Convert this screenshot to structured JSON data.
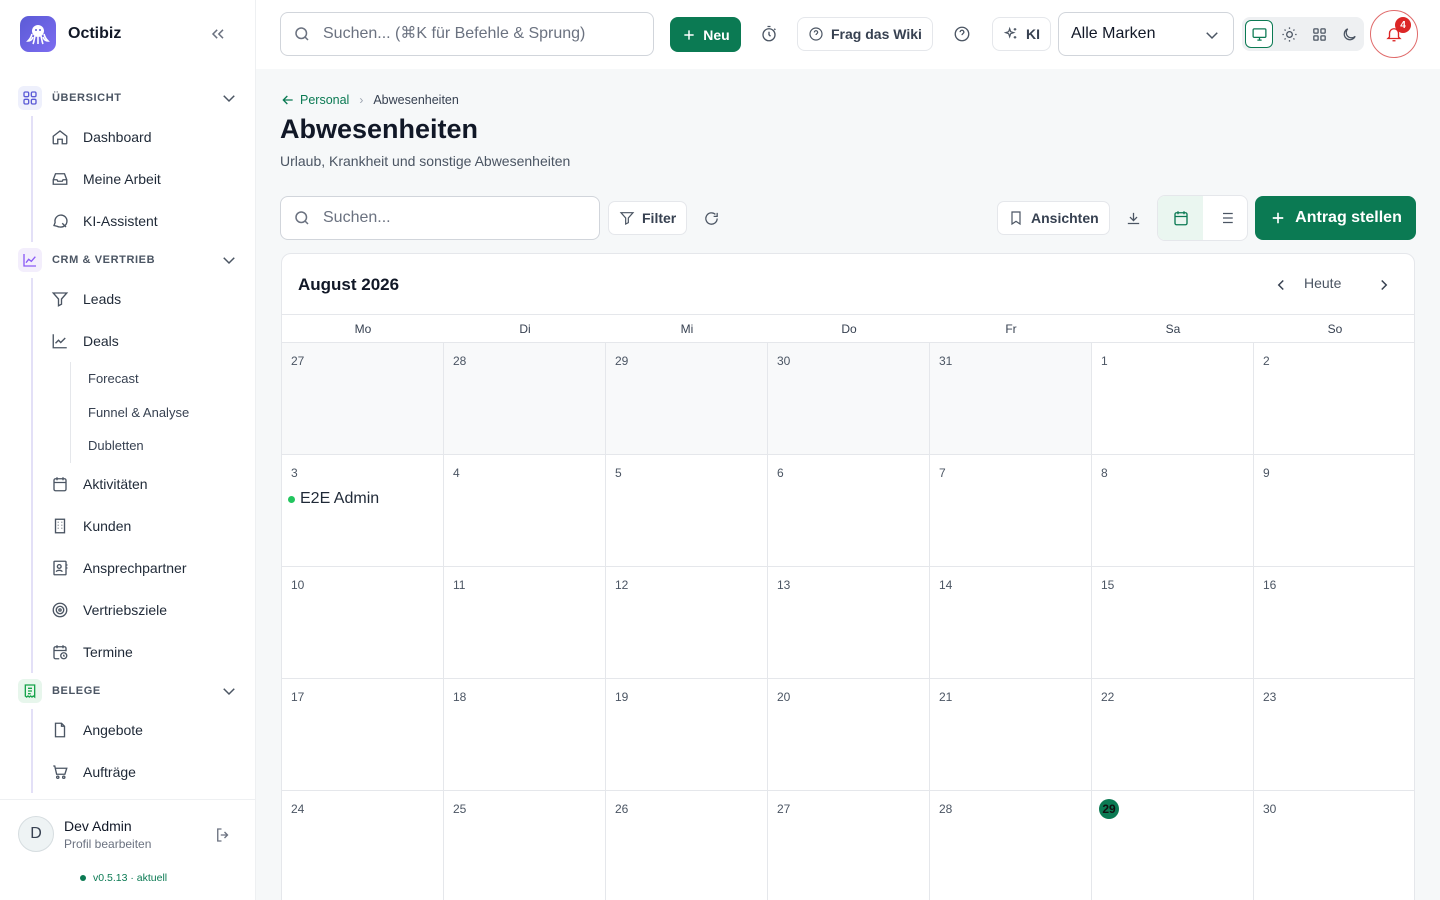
{
  "app": {
    "name": "Octibiz"
  },
  "sidebar": {
    "sections": [
      {
        "label": "ÜBERSICHT",
        "items": [
          "Dashboard",
          "Meine Arbeit",
          "KI-Assistent"
        ]
      },
      {
        "label": "CRM & VERTRIEB",
        "items": [
          "Leads",
          "Deals",
          "Aktivitäten",
          "Kunden",
          "Ansprechpartner",
          "Vertriebsziele",
          "Termine"
        ],
        "deals_sub": [
          "Forecast",
          "Funnel & Analyse",
          "Dubletten"
        ]
      },
      {
        "label": "BELEGE",
        "items": [
          "Angebote",
          "Aufträge"
        ]
      }
    ],
    "user": {
      "initial": "D",
      "name": "Dev Admin",
      "sub": "Profil bearbeiten"
    },
    "version": "v0.5.13 · aktuell"
  },
  "topbar": {
    "search_placeholder": "Suchen... (⌘K für Befehle & Sprung)",
    "new_label": "Neu",
    "wiki_label": "Frag das Wiki",
    "ai_label": "KI",
    "brand_select": "Alle Marken",
    "notifications": "4"
  },
  "page": {
    "breadcrumb": {
      "parent": "Personal",
      "current": "Abwesenheiten"
    },
    "title": "Abwesenheiten",
    "subtitle": "Urlaub, Krankheit und sonstige Abwesenheiten",
    "search_placeholder": "Suchen...",
    "filter_label": "Filter",
    "views_label": "Ansichten",
    "primary_label": "Antrag stellen"
  },
  "calendar": {
    "title": "August 2026",
    "today_label": "Heute",
    "weekdays": [
      "Mo",
      "Di",
      "Mi",
      "Do",
      "Fr",
      "Sa",
      "So"
    ],
    "days": [
      {
        "n": "27",
        "out": true
      },
      {
        "n": "28",
        "out": true
      },
      {
        "n": "29",
        "out": true
      },
      {
        "n": "30",
        "out": true
      },
      {
        "n": "31",
        "out": true
      },
      {
        "n": "1"
      },
      {
        "n": "2"
      },
      {
        "n": "3",
        "event": "E2E Admin"
      },
      {
        "n": "4"
      },
      {
        "n": "5"
      },
      {
        "n": "6"
      },
      {
        "n": "7"
      },
      {
        "n": "8"
      },
      {
        "n": "9"
      },
      {
        "n": "10"
      },
      {
        "n": "11"
      },
      {
        "n": "12"
      },
      {
        "n": "13"
      },
      {
        "n": "14"
      },
      {
        "n": "15"
      },
      {
        "n": "16"
      },
      {
        "n": "17"
      },
      {
        "n": "18"
      },
      {
        "n": "19"
      },
      {
        "n": "20"
      },
      {
        "n": "21"
      },
      {
        "n": "22"
      },
      {
        "n": "23"
      },
      {
        "n": "24"
      },
      {
        "n": "25"
      },
      {
        "n": "26"
      },
      {
        "n": "27"
      },
      {
        "n": "28"
      },
      {
        "n": "29",
        "today": true
      },
      {
        "n": "30"
      }
    ]
  },
  "colors": {
    "accent": "#0b7a53",
    "event_dot": "#22c55e",
    "alert": "#dc2626"
  }
}
